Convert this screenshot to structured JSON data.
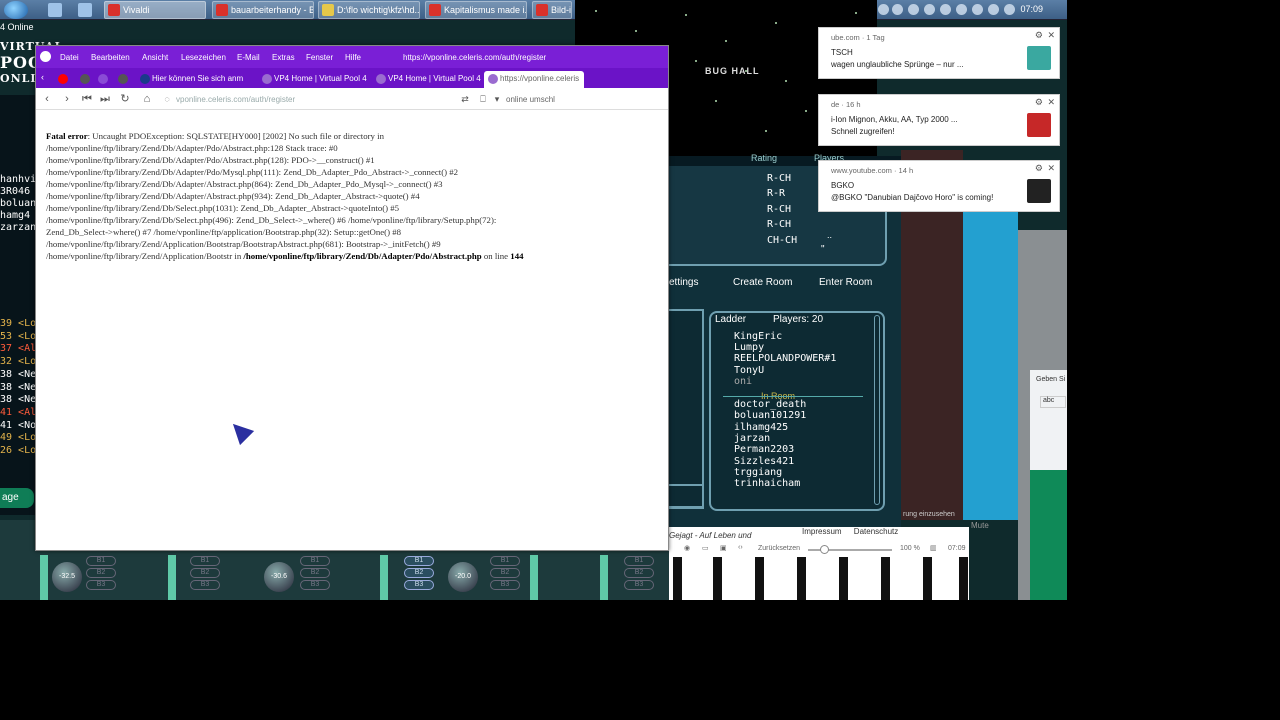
{
  "taskbar": {
    "tasks": [
      {
        "label": "Vivaldi",
        "color": "#d9312b",
        "active": true
      },
      {
        "label": "bauarbeiterhandy - B...",
        "color": "#d9312b"
      },
      {
        "label": "D:\\flo wichtig\\kfz\\hd...",
        "color": "#e6c84a"
      },
      {
        "label": "Kapitalismus made i...",
        "color": "#d9312b"
      },
      {
        "label": "Bild-in",
        "color": "#d9312b"
      }
    ],
    "clock": "07:09"
  },
  "game_left": {
    "online": "4 Online",
    "logo_line1": "VIRTUAL",
    "logo_line2": "POOL",
    "logo_line3": "ONLIN",
    "names": [
      "hanhvi",
      "3R046",
      "boluan1",
      "hamg4",
      "zarzan's"
    ],
    "chat": [
      {
        "text": "39 <Lo",
        "color": "#e3b34b"
      },
      {
        "text": "53 <Lo",
        "color": "#e3b34b"
      },
      {
        "text": "37 <Al",
        "color": "#ff5b3b"
      },
      {
        "text": "32 <Lo",
        "color": "#e3b34b"
      },
      {
        "text": "38 <Ne",
        "color": "#ffffff"
      },
      {
        "text": "38 <Ne",
        "color": "#ffffff"
      },
      {
        "text": "38 <Ne",
        "color": "#ffffff"
      },
      {
        "text": "41 <Al",
        "color": "#ff5b3b"
      },
      {
        "text": "41 <No",
        "color": "#ffffff"
      },
      {
        "text": "49 <Lo",
        "color": "#e3b34b"
      },
      {
        "text": "26 <Lo",
        "color": "#e3b34b"
      }
    ],
    "button": "age"
  },
  "mixer": {
    "knob1": "-32.5",
    "knob2": "-30.6",
    "knob3": "-20.0",
    "pill_labels": [
      "B1",
      "B2",
      "B3"
    ]
  },
  "browser": {
    "menu": [
      "Datei",
      "Bearbeiten",
      "Ansicht",
      "Lesezeichen",
      "E-Mail",
      "Extras",
      "Fenster",
      "Hilfe"
    ],
    "title_url": "https://vponline.celeris.com/auth/register",
    "tabs": [
      {
        "label": "",
        "color": "#ff0000"
      },
      {
        "label": "",
        "color": "#555555"
      },
      {
        "label": "",
        "color": "#8a4bd6"
      },
      {
        "label": "",
        "color": "#555555"
      },
      {
        "label": "Hier können Sie sich anm",
        "color": "#1a3a8a"
      },
      {
        "label": "VP4 Home | Virtual Pool 4",
        "color": "#9a6bd0"
      },
      {
        "label": "VP4 Home | Virtual Pool 4",
        "color": "#9a6bd0"
      },
      {
        "label": "https://vponline.celeris",
        "color": "#9a6bd0",
        "active": true
      }
    ],
    "url": "vponline.celeris.com/auth/register",
    "search_placeholder": "online umschl",
    "error_label": "Fatal error",
    "error_lines": [
      ": Uncaught PDOException: SQLSTATE[HY000] [2002] No such file or directory in",
      "/home/vponline/ftp/library/Zend/Db/Adapter/Pdo/Abstract.php:128 Stack trace: #0",
      "/home/vponline/ftp/library/Zend/Db/Adapter/Pdo/Abstract.php(128): PDO->__construct() #1",
      "/home/vponline/ftp/library/Zend/Db/Adapter/Pdo/Mysql.php(111): Zend_Db_Adapter_Pdo_Abstract->_connect() #2",
      "/home/vponline/ftp/library/Zend/Db/Adapter/Abstract.php(864): Zend_Db_Adapter_Pdo_Mysql->_connect() #3",
      "/home/vponline/ftp/library/Zend/Db/Adapter/Abstract.php(934): Zend_Db_Adapter_Abstract->quote() #4",
      "/home/vponline/ftp/library/Zend/Db/Select.php(1031): Zend_Db_Adapter_Abstract->quoteInto() #5",
      "/home/vponline/ftp/library/Zend/Db/Select.php(496): Zend_Db_Select->_where() #6 /home/vponline/ftp/library/Setup.php(72):",
      "Zend_Db_Select->where() #7 /home/vponline/ftp/application/Bootstrap.php(32): Setup::getOne() #8",
      "/home/vponline/ftp/library/Zend/Application/Bootstrap/BootstrapAbstract.php(681): Bootstrap->_initFetch() #9",
      "/home/vponline/ftp/library/Zend/Application/Bootstr in"
    ],
    "error_file": "/home/vponline/ftp/library/Zend/Db/Adapter/Pdo/Abstract.php",
    "error_online": " on line ",
    "error_lineno": "144"
  },
  "video": {
    "title": "BUG HALL"
  },
  "lobby": {
    "header_rating": "Rating",
    "header_players": "Players",
    "ratings": [
      "R-CH",
      "R-R",
      "R-CH",
      "R-CH",
      "CH-CH"
    ],
    "buttons": {
      "settings": "ettings",
      "create": "Create Room",
      "enter": "Enter Room"
    },
    "ladder_title": "Ladder",
    "players_label": "Players:",
    "players_count": "20",
    "top_players": [
      "KingEric",
      "Lumpy",
      "REELPOLANDPOWER#1",
      "TonyU",
      "oni"
    ],
    "in_room_label": "In Room",
    "room_players": [
      "doctor_death",
      "boluan101291",
      "ilhamg425",
      "jarzan",
      "Perman2203",
      "Sizzles421",
      "trggiang",
      "trinhaicham"
    ]
  },
  "notifications": [
    {
      "source": "ube.com · 1 Tag",
      "title": "TSCH",
      "body": "wagen unglaubliche Sprünge – nur ...",
      "thumb": "#3aa8a0"
    },
    {
      "source": "de · 16 h",
      "title": "i-Ion Mignon, Akku, AA, Typ 2000 ...",
      "body": "Schnell zugreifen!",
      "thumb": "#c62828"
    },
    {
      "source": "www.youtube.com · 14 h",
      "title": "BGKO",
      "body": "@BGKO \"Danubian Dajčovo Horo\" is coming!",
      "thumb": "#222222"
    }
  ],
  "right_panel": {
    "text": "Geben Si",
    "badge": "abc"
  },
  "right_dark_caption": "rung einzusehen",
  "mute_label": "Mute",
  "player": {
    "track": "Gejagt - Auf Leben und",
    "impressum": "Impressum",
    "datenschutz": "Datenschutz",
    "reset": "Zurücksetzen",
    "zoom": "100 %",
    "time": "07:09"
  }
}
